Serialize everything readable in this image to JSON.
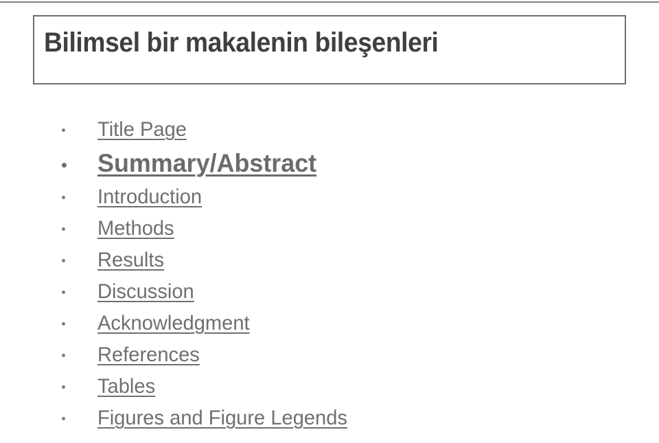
{
  "slide": {
    "title": "Bilimsel bir makalenin bileşenleri",
    "title_color": "#3f3f3f",
    "title_border_color": "#6e6e6e",
    "body_text_color": "#6f6f6f",
    "bullet_color": "#7d7d7d",
    "background_color": "#ffffff",
    "bullets": [
      {
        "label": "Title Page",
        "emphasis": false
      },
      {
        "label": "Summary/Abstract",
        "emphasis": true
      },
      {
        "label": "Introduction",
        "emphasis": false
      },
      {
        "label": "Methods",
        "emphasis": false
      },
      {
        "label": "Results",
        "emphasis": false
      },
      {
        "label": "Discussion",
        "emphasis": false
      },
      {
        "label": "Acknowledgment",
        "emphasis": false
      },
      {
        "label": "References",
        "emphasis": false
      },
      {
        "label": "Tables",
        "emphasis": false
      },
      {
        "label": "Figures and Figure Legends",
        "emphasis": false
      }
    ]
  }
}
